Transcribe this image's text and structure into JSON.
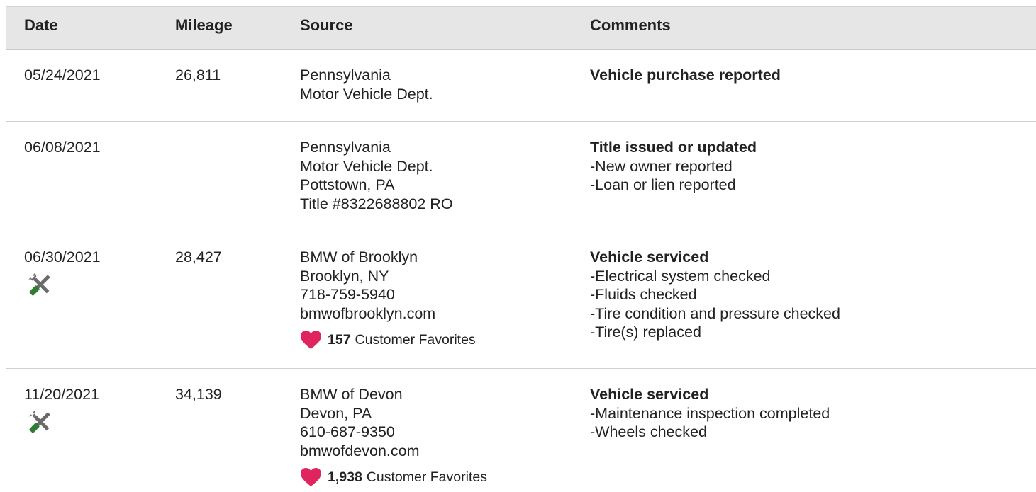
{
  "columns": [
    "Date",
    "Mileage",
    "Source",
    "Comments"
  ],
  "rows": [
    {
      "date": "05/24/2021",
      "mileage": "26,811",
      "source": [
        "Pennsylvania",
        "Motor Vehicle Dept."
      ],
      "comment_title": "Vehicle purchase reported",
      "comment_items": []
    },
    {
      "date": "06/08/2021",
      "mileage": "",
      "source": [
        "Pennsylvania",
        "Motor Vehicle Dept.",
        "Pottstown, PA",
        "Title #8322688802 RO"
      ],
      "comment_title": "Title issued or updated",
      "comment_items": [
        "New owner reported",
        "Loan or lien reported"
      ]
    },
    {
      "date": "06/30/2021",
      "mileage": "28,427",
      "icon": "wrench-screwdriver-icon",
      "source": [
        "BMW of Brooklyn",
        "Brooklyn, NY",
        "718-759-5940",
        "bmwofbrooklyn.com"
      ],
      "favorites_count": "157",
      "favorites_label": "Customer Favorites",
      "comment_title": "Vehicle serviced",
      "comment_items": [
        "Electrical system checked",
        "Fluids checked",
        "Tire condition and pressure checked",
        "Tire(s) replaced"
      ]
    },
    {
      "date": "11/20/2021",
      "mileage": "34,139",
      "icon": "wrench-screwdriver-icon",
      "source": [
        "BMW of Devon",
        "Devon, PA",
        "610-687-9350",
        "bmwofdevon.com"
      ],
      "favorites_count": "1,938",
      "favorites_label": "Customer Favorites",
      "comment_title": "Vehicle serviced",
      "comment_items": [
        "Maintenance inspection completed",
        "Wheels checked"
      ]
    }
  ],
  "colors": {
    "header_bg": "#e6e6e6",
    "heart": "#e0245e",
    "tool_green": "#2e7d32",
    "tool_gray": "#6b6b6b"
  }
}
